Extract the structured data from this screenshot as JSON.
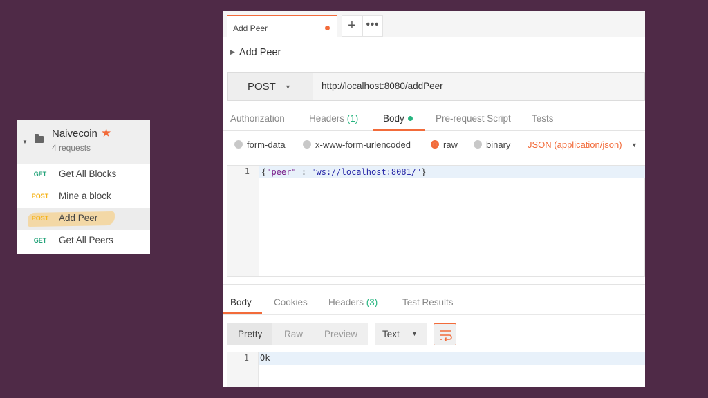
{
  "collection": {
    "name": "Naivecoin",
    "count": "4 requests",
    "requests": [
      {
        "method": "GET",
        "label": "Get All Blocks"
      },
      {
        "method": "POST",
        "label": "Mine a block"
      },
      {
        "method": "POST",
        "label": "Add Peer",
        "active": true
      },
      {
        "method": "GET",
        "label": "Get All Peers"
      }
    ]
  },
  "tabs": {
    "active_title": "Add Peer",
    "new_tab": "+",
    "more": "•••"
  },
  "request": {
    "name": "Add Peer",
    "method": "POST",
    "url": "http://localhost:8080/addPeer",
    "tabs": {
      "authorization": "Authorization",
      "headers": "Headers",
      "headers_count": "(1)",
      "body": "Body",
      "prerequest": "Pre-request Script",
      "tests": "Tests"
    },
    "body_types": {
      "form_data": "form-data",
      "urlencoded": "x-www-form-urlencoded",
      "raw": "raw",
      "binary": "binary",
      "content_type": "JSON (application/json)"
    },
    "body": {
      "line_number": "1",
      "open": "{",
      "key": "\"peer\"",
      "colon": " : ",
      "value": "\"ws://localhost:8081/\"",
      "close": "}"
    }
  },
  "response": {
    "tabs": {
      "body": "Body",
      "cookies": "Cookies",
      "headers": "Headers",
      "headers_count": "(3)",
      "test_results": "Test Results"
    },
    "views": {
      "pretty": "Pretty",
      "raw": "Raw",
      "preview": "Preview",
      "format": "Text"
    },
    "line_number": "1",
    "content": "Ok"
  },
  "colors": {
    "accent": "#f26b3a",
    "get": "#24a37a",
    "post": "#f5b31a",
    "background": "#4f2a47"
  }
}
